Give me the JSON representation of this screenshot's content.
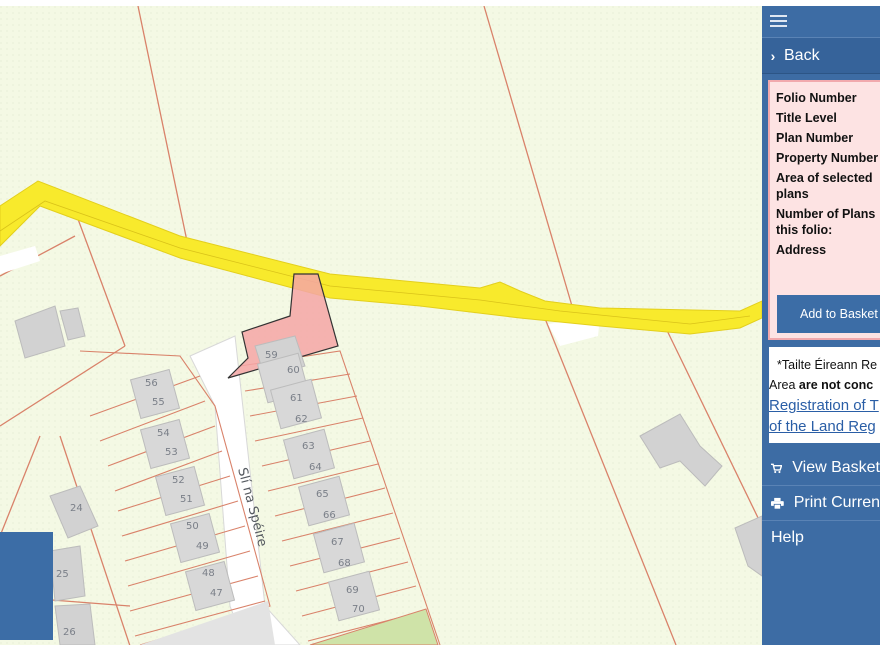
{
  "sidebar": {
    "back_label": "Back",
    "folio": {
      "folio_number_label": "Folio Number",
      "title_level_label": "Title Level",
      "plan_number_label": "Plan Number",
      "property_number_label": "Property Number",
      "area_label": "Area of selected plans",
      "num_plans_label": "Number of Plans this folio:",
      "address_label": "Address"
    },
    "add_basket_label": "Add to Basket",
    "notice": {
      "line1": "*Tailte Éireann Re",
      "line2_prefix": "Area ",
      "line2_bold": "are not conc",
      "link1": "Registration of T",
      "link2": "of the Land Reg"
    },
    "view_basket_label": "View Basket",
    "print_label": "Print Curren",
    "help_label": "Help",
    "icons": [
      "menu-icon",
      "chevron-right-icon",
      "cart-icon",
      "printer-icon"
    ]
  },
  "map": {
    "road_name": "Slí na Spéire",
    "plots_west": [
      "56",
      "55",
      "54",
      "53",
      "52",
      "51",
      "50",
      "49",
      "48",
      "47"
    ],
    "plots_east": [
      "59",
      "60",
      "61",
      "62",
      "63",
      "64",
      "65",
      "66",
      "67",
      "68",
      "69",
      "70"
    ],
    "plots_misc": [
      "24",
      "25",
      "26"
    ],
    "colors": {
      "background": "#f4f9e4",
      "boundary": "#d9826a",
      "highlight_band": "#f8ea2c",
      "selected_plot": "#f4a6a6",
      "buildings": "#d2d2d2",
      "sidebar": "#3d6ca4"
    }
  }
}
